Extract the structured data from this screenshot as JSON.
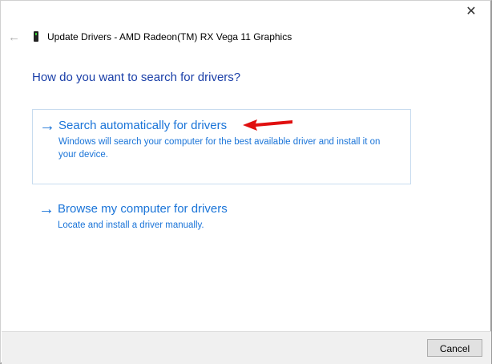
{
  "window": {
    "close_label": "✕",
    "back_icon": "←",
    "title": "Update Drivers - AMD Radeon(TM) RX Vega 11 Graphics"
  },
  "heading": "How do you want to search for drivers?",
  "options": [
    {
      "arrow": "→",
      "title": "Search automatically for drivers",
      "description": "Windows will search your computer for the best available driver and install it on your device."
    },
    {
      "arrow": "→",
      "title": "Browse my computer for drivers",
      "description": "Locate and install a driver manually."
    }
  ],
  "footer": {
    "cancel_label": "Cancel"
  },
  "colors": {
    "link": "#1a74d8",
    "heading": "#1a3fa8",
    "annotation": "#e01010"
  }
}
